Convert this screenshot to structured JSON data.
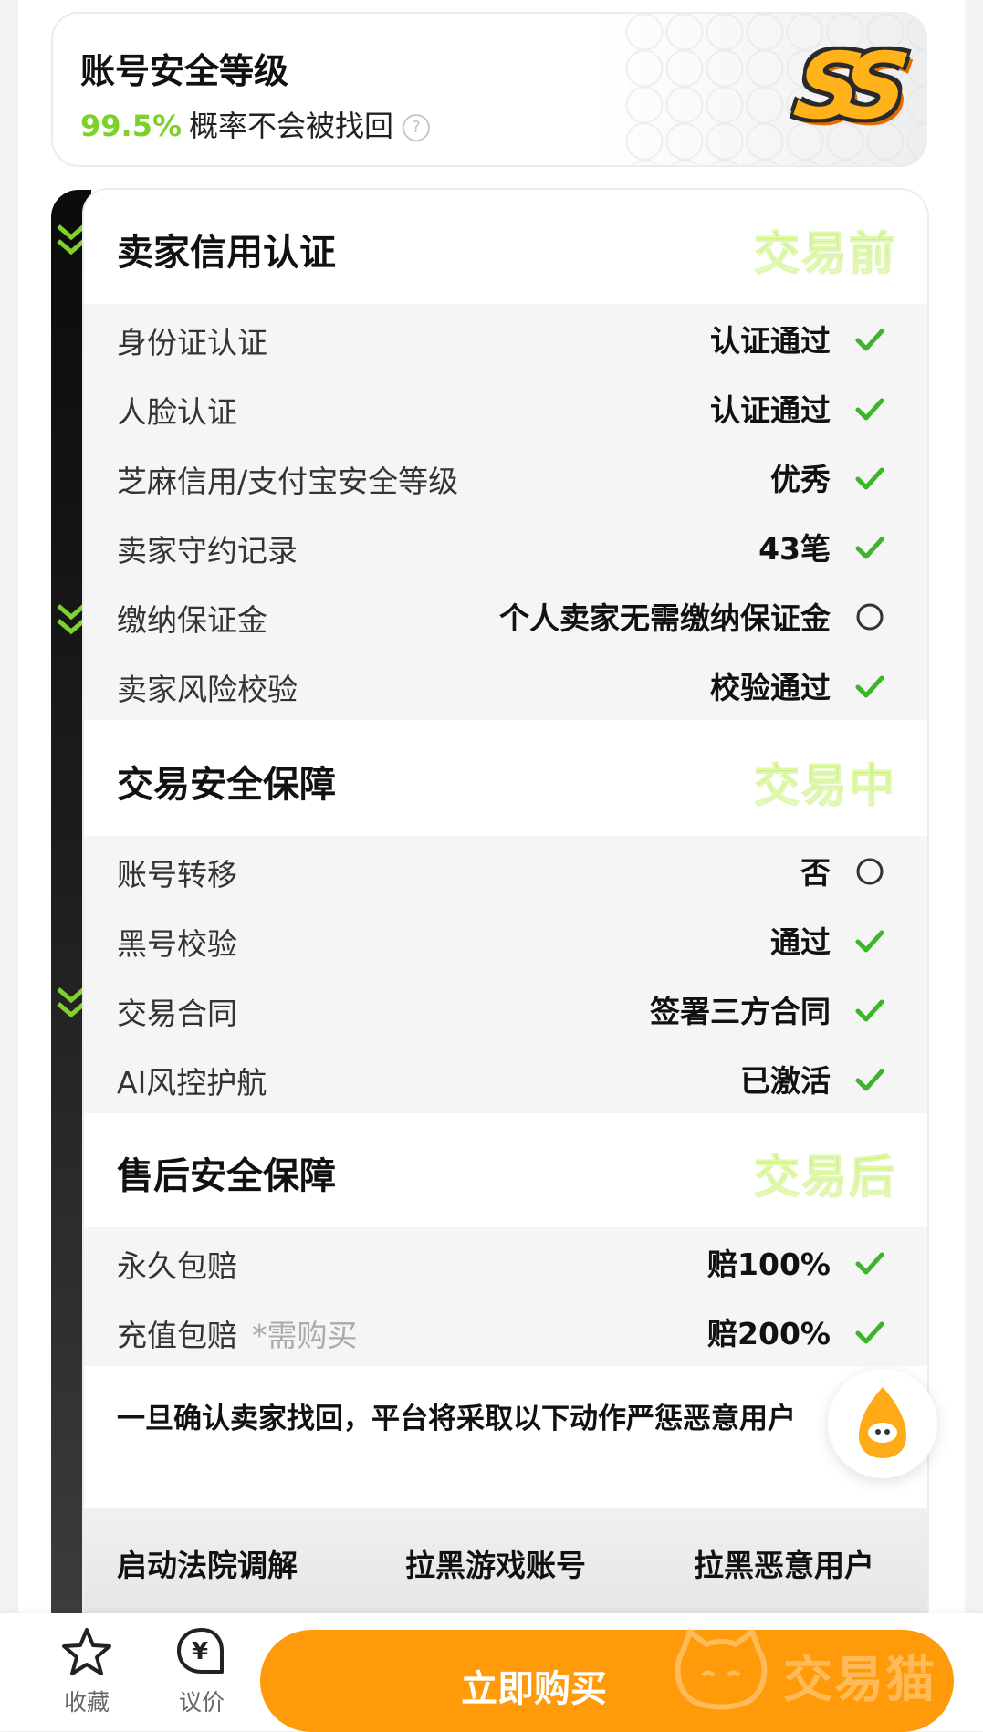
{
  "security_level": {
    "title": "账号安全等级",
    "percent": "99.5%",
    "description": "概率不会被找回",
    "help_icon": "question-circle-icon",
    "rank": "SS"
  },
  "sections": [
    {
      "title": "交易安全保障",
      "stage": "交易中"
    }
  ],
  "seller_credit": {
    "title": "卖家信用认证",
    "stage": "交易前",
    "rows": [
      {
        "label": "身份证认证",
        "value": "认证通过",
        "status": "check"
      },
      {
        "label": "人脸认证",
        "value": "认证通过",
        "status": "check"
      },
      {
        "label": "芝麻信用/支付宝安全等级",
        "value": "优秀",
        "status": "check"
      },
      {
        "label": "卖家守约记录",
        "value": "43笔",
        "status": "check"
      },
      {
        "label": "缴纳保证金",
        "value": "个人卖家无需缴纳保证金",
        "status": "circle"
      },
      {
        "label": "卖家风险校验",
        "value": "校验通过",
        "status": "check"
      }
    ]
  },
  "trade_safety": {
    "title": "交易安全保障",
    "stage": "交易中",
    "rows": [
      {
        "label": "账号转移",
        "value": "否",
        "status": "circle"
      },
      {
        "label": "黑号校验",
        "value": "通过",
        "status": "check"
      },
      {
        "label": "交易合同",
        "value": "签署三方合同",
        "status": "check"
      },
      {
        "label": "AI风控护航",
        "value": "已激活",
        "status": "check"
      }
    ]
  },
  "after_sale": {
    "title": "售后安全保障",
    "stage": "交易后",
    "rows": [
      {
        "label": "永久包赔",
        "note": "",
        "value": "赔100%",
        "status": "check"
      },
      {
        "label": "充值包赔",
        "note": "*需购买",
        "value": "赔200%",
        "status": "check"
      }
    ]
  },
  "notice": {
    "text": "一旦确认卖家找回，平台将采取以下动作严惩恶意用户",
    "actions": [
      "启动法院调解",
      "拉黑游戏账号",
      "拉黑恶意用户"
    ]
  },
  "bottom_bar": {
    "favorite_label": "收藏",
    "bargain_label": "议价",
    "buy_label": "立即购买",
    "watermark": "交易猫"
  },
  "colors": {
    "accent_orange": "#ff9a0a",
    "percent_green": "#7dd12a",
    "check_green": "#3db52a",
    "stage_green": "#b8ee3c"
  }
}
